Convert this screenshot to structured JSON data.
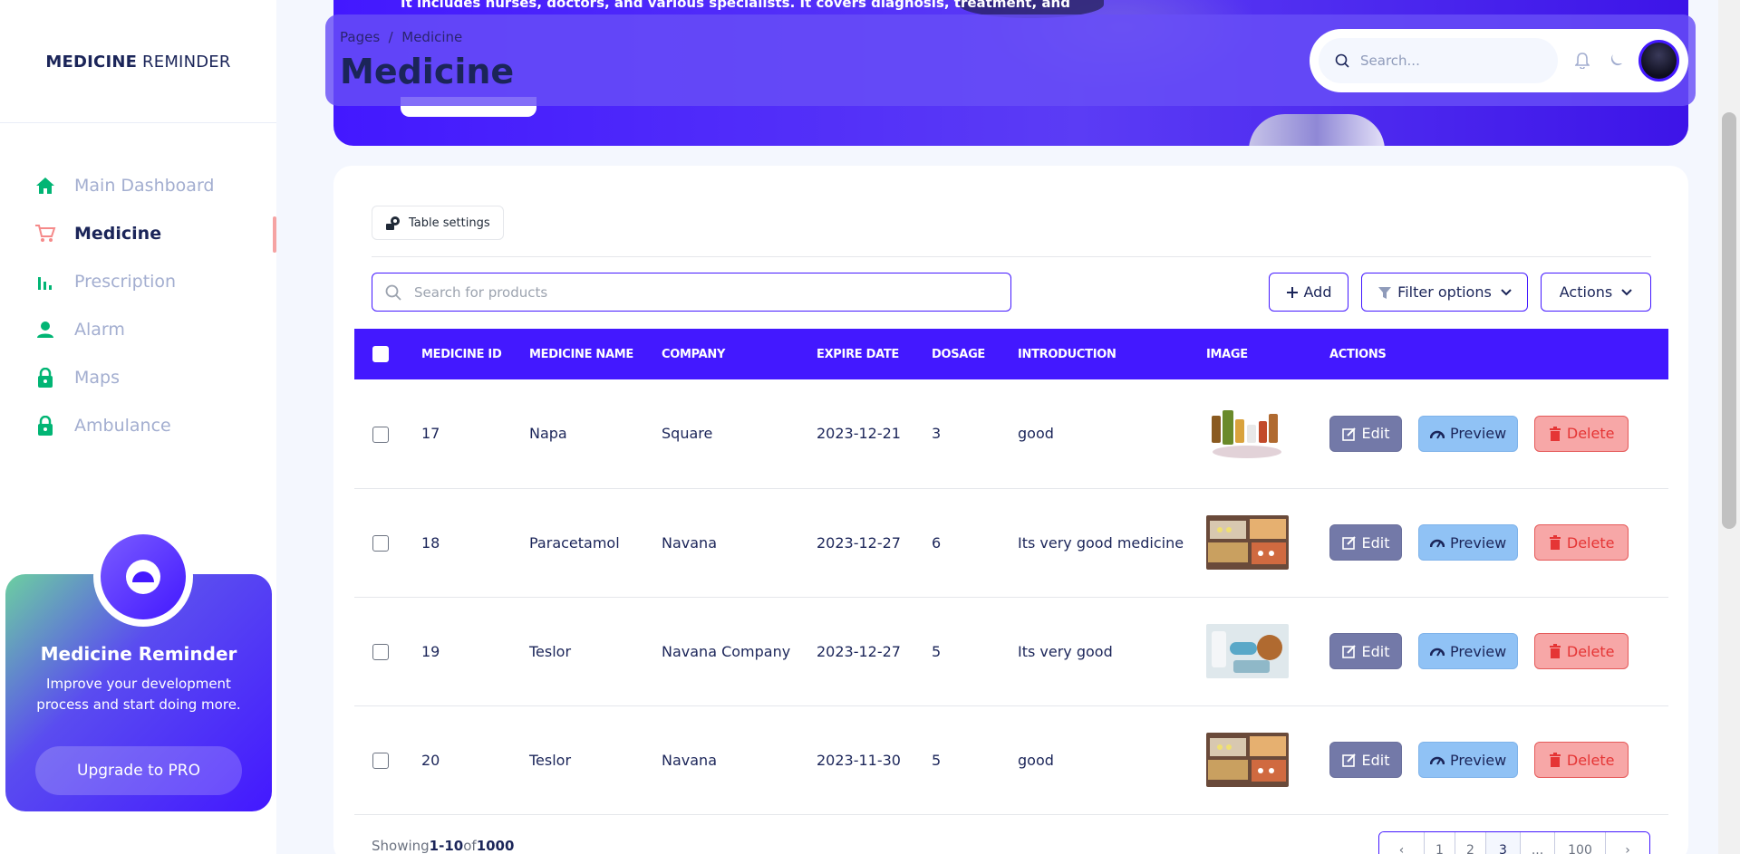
{
  "sidebar": {
    "brand_bold": "MEDICINE",
    "brand_light": " REMINDER",
    "items": [
      {
        "label": "Main Dashboard"
      },
      {
        "label": "Medicine"
      },
      {
        "label": "Prescription"
      },
      {
        "label": "Alarm"
      },
      {
        "label": "Maps"
      },
      {
        "label": "Ambulance"
      }
    ],
    "promo": {
      "title": "Medicine Reminder",
      "text": "Improve your development process and start doing more.",
      "button": "Upgrade to PRO"
    }
  },
  "banner": {
    "text": "It includes nurses, doctors, and various specialists. It covers diagnosis, treatment, and"
  },
  "header": {
    "breadcrumb": "Pages  /  Medicine",
    "title": "Medicine",
    "search_placeholder": "Search..."
  },
  "toolbar": {
    "table_settings": "Table settings",
    "search_placeholder": "Search for products",
    "add": "Add",
    "filter": "Filter options",
    "actions": "Actions"
  },
  "table": {
    "columns": [
      "MEDICINE ID",
      "MEDICINE NAME",
      "COMPANY",
      "EXPIRE DATE",
      "DOSAGE",
      "INTRODUCTION",
      "IMAGE",
      "ACTIONS"
    ],
    "rows": [
      {
        "id": "17",
        "name": "Napa",
        "company": "Square",
        "expire": "2023-12-21",
        "dosage": "3",
        "intro": "good"
      },
      {
        "id": "18",
        "name": "Paracetamol",
        "company": "Navana",
        "expire": "2023-12-27",
        "dosage": "6",
        "intro": "Its very good medicine"
      },
      {
        "id": "19",
        "name": "Teslor",
        "company": "Navana Company",
        "expire": "2023-12-27",
        "dosage": "5",
        "intro": "Its very good"
      },
      {
        "id": "20",
        "name": "Teslor",
        "company": "Navana",
        "expire": "2023-11-30",
        "dosage": "5",
        "intro": "good"
      }
    ],
    "edit_label": "Edit",
    "preview_label": "Preview",
    "delete_label": "Delete"
  },
  "footer": {
    "showing_prefix": "Showing",
    "range": "1-10",
    "of": "of",
    "total": "1000",
    "pages": [
      "‹",
      "1",
      "2",
      "3",
      "...",
      "100",
      "›"
    ]
  },
  "colors": {
    "accent": "#4318ff",
    "nav_icon": "#01b574"
  }
}
